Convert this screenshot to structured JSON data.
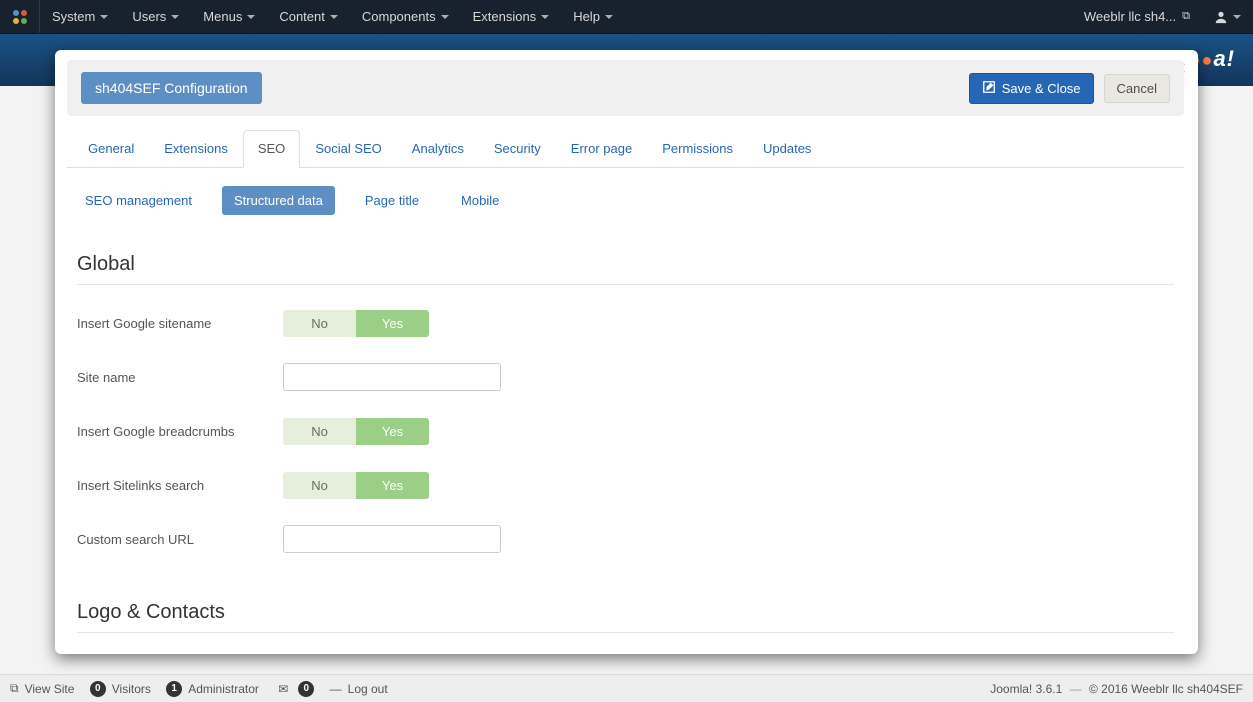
{
  "topnav": {
    "menu": [
      "System",
      "Users",
      "Menus",
      "Content",
      "Components",
      "Extensions",
      "Help"
    ],
    "site": "Weeblr llc sh4..."
  },
  "brand_logo": "a!",
  "modal": {
    "title": "sh404SEF Configuration",
    "save": "Save & Close",
    "cancel": "Cancel",
    "main_tabs": [
      "General",
      "Extensions",
      "SEO",
      "Social SEO",
      "Analytics",
      "Security",
      "Error page",
      "Permissions",
      "Updates"
    ],
    "active_tab": "SEO",
    "sub_pills": [
      "SEO management",
      "Structured data",
      "Page title",
      "Mobile"
    ],
    "active_pill": "Structured data",
    "sections": {
      "global": {
        "title": "Global",
        "fields": {
          "insert_sitename": {
            "label": "Insert Google sitename",
            "no": "No",
            "yes": "Yes",
            "value": "yes"
          },
          "site_name": {
            "label": "Site name",
            "value": ""
          },
          "insert_bc": {
            "label": "Insert Google breadcrumbs",
            "no": "No",
            "yes": "Yes",
            "value": "yes"
          },
          "insert_sl": {
            "label": "Insert Sitelinks search",
            "no": "No",
            "yes": "Yes",
            "value": "yes"
          },
          "custom_url": {
            "label": "Custom search URL",
            "value": ""
          }
        }
      },
      "logo": {
        "title": "Logo & Contacts"
      }
    }
  },
  "statusbar": {
    "viewsite": "View Site",
    "visitors_n": "0",
    "visitors": "Visitors",
    "admin_n": "1",
    "admin": "Administrator",
    "msg_n": "0",
    "logout": "Log out",
    "joomla": "Joomla! 3.6.1",
    "copyright": "© 2016 Weeblr llc sh404SEF",
    "dash": "—"
  }
}
